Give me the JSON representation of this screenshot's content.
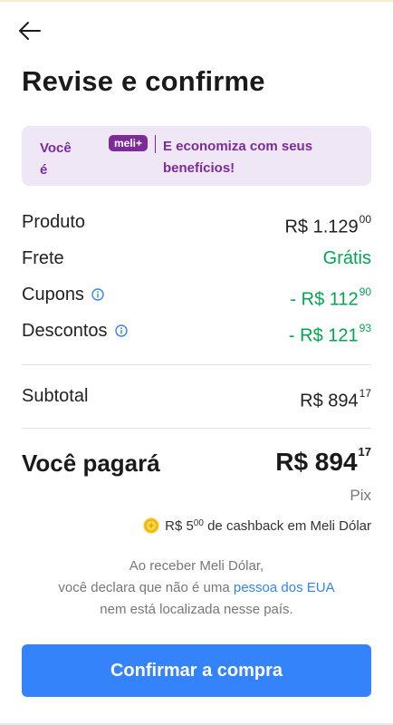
{
  "header": {
    "back_icon": "arrow-left-icon",
    "title": "Revise e confirme"
  },
  "meli_banner": {
    "voce_line1": "Você",
    "voce_line2": "é",
    "badge": "meli+",
    "benefit_line1": "E economiza com seus",
    "benefit_line2": "benefícios!",
    "color": "#7b2b9a",
    "background": "#efe7f6"
  },
  "summary": {
    "produto": {
      "label": "Produto",
      "value": "R$ 1.129",
      "cents": "00"
    },
    "frete": {
      "label": "Frete",
      "value": "Grátis"
    },
    "cupons": {
      "label": "Cupons",
      "value": "- R$ 112",
      "cents": "90",
      "icon": "info-icon"
    },
    "descontos": {
      "label": "Descontos",
      "value": "- R$ 121",
      "cents": "93",
      "icon": "info-icon"
    },
    "subtotal": {
      "label": "Subtotal",
      "value": "R$ 894",
      "cents": "17"
    }
  },
  "total": {
    "label": "Você pagará",
    "value": "R$ 894",
    "cents": "17",
    "method": "Pix"
  },
  "cashback": {
    "icon": "coin-icon",
    "amount": "R$ 5",
    "cents": "00",
    "text": " de cashback em Meli Dólar"
  },
  "disclaimer": {
    "line1": "Ao receber Meli Dólar,",
    "line2_before": "você declara que não é uma ",
    "line2_link": "pessoa dos EUA",
    "line3": "nem está localizada nesse país."
  },
  "confirm_button": "Confirmar a compra",
  "colors": {
    "primary": "#3483fa",
    "green": "#00a650",
    "purple": "#7b2b9a"
  }
}
